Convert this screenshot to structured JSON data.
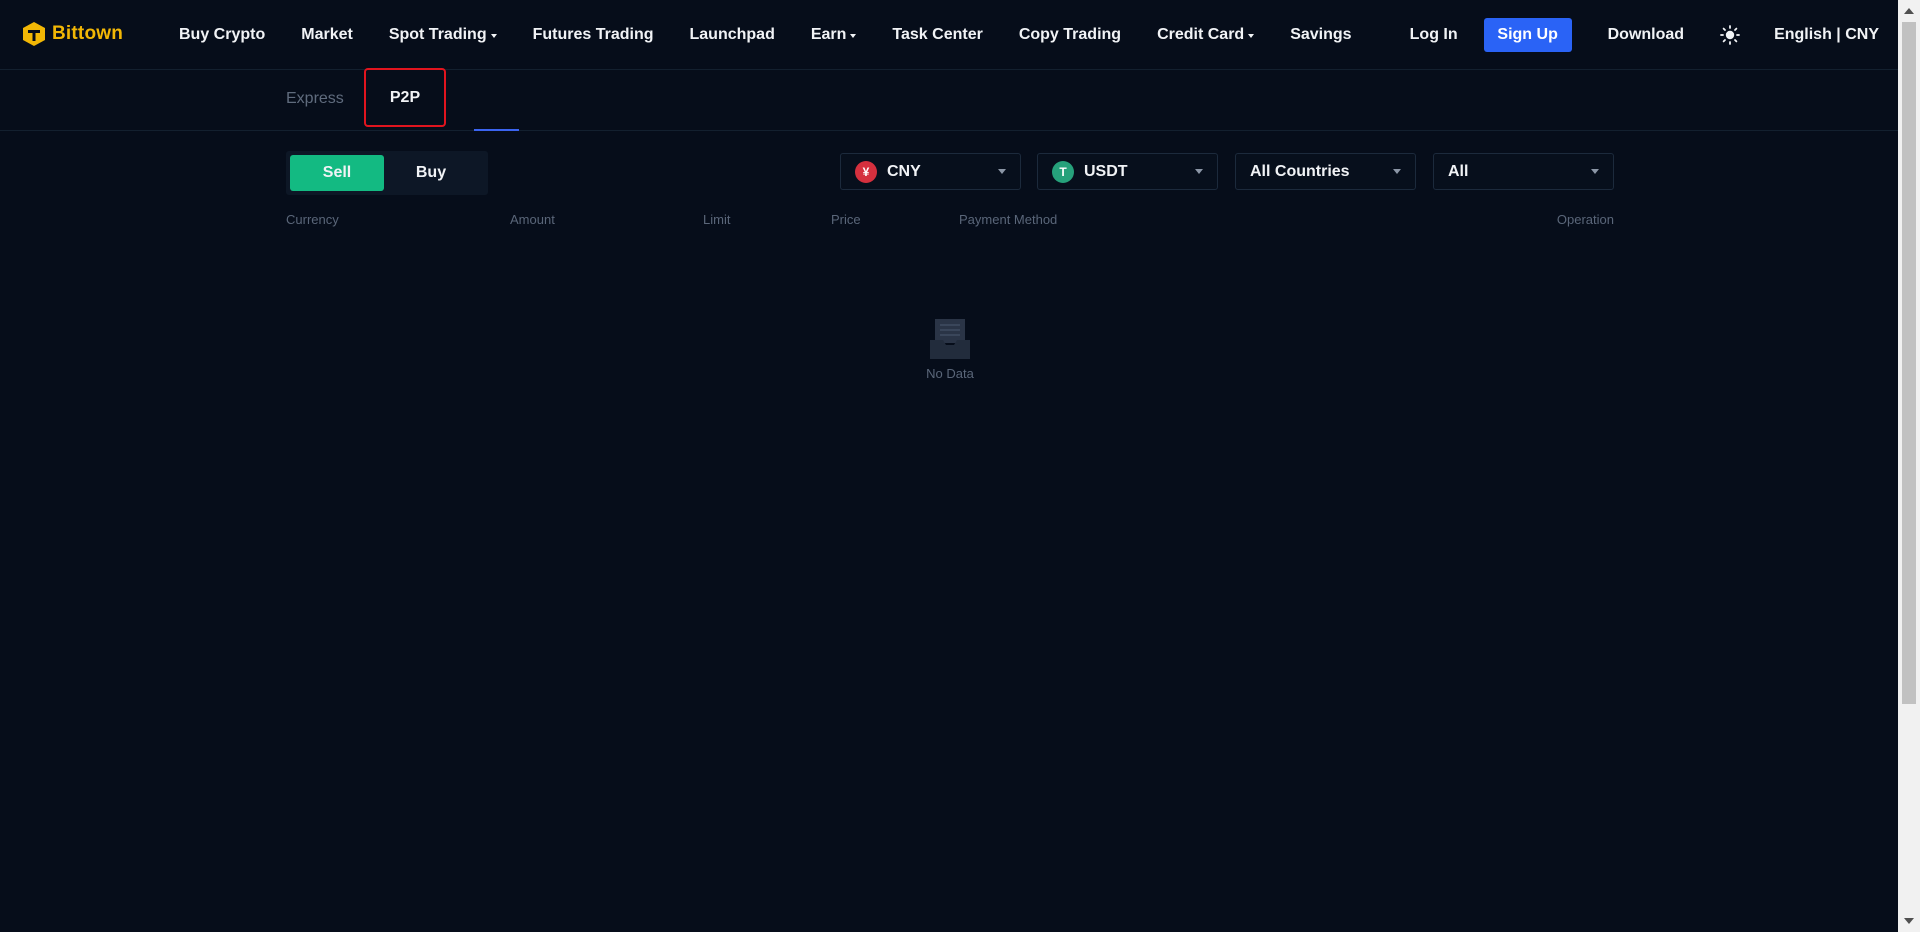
{
  "brand": {
    "name": "Bittown",
    "accent": "#f2b705"
  },
  "nav": {
    "items": [
      {
        "label": "Buy Crypto",
        "dropdown": false
      },
      {
        "label": "Market",
        "dropdown": false
      },
      {
        "label": "Spot Trading",
        "dropdown": true
      },
      {
        "label": "Futures Trading",
        "dropdown": false
      },
      {
        "label": "Launchpad",
        "dropdown": false
      },
      {
        "label": "Earn",
        "dropdown": true
      },
      {
        "label": "Task Center",
        "dropdown": false
      },
      {
        "label": "Copy Trading",
        "dropdown": false
      },
      {
        "label": "Credit Card",
        "dropdown": true
      },
      {
        "label": "Savings",
        "dropdown": false
      }
    ],
    "login_label": "Log In",
    "signup_label": "Sign Up",
    "download_label": "Download",
    "theme_icon": "sun-icon",
    "language_label": "English | CNY"
  },
  "tabs": {
    "express_label": "Express",
    "p2p_label": "P2P",
    "active": "P2P"
  },
  "filters": {
    "sell_label": "Sell",
    "buy_label": "Buy",
    "active_side": "Sell",
    "fiat": {
      "value": "CNY",
      "icon_glyph": "¥",
      "icon_color": "#d5303e"
    },
    "crypto": {
      "value": "USDT",
      "icon_glyph": "T",
      "icon_color": "#26a17b"
    },
    "country": {
      "value": "All Countries"
    },
    "payment": {
      "value": "All"
    }
  },
  "table": {
    "columns": [
      "Currency",
      "Amount",
      "Limit",
      "Price",
      "Payment Method",
      "Operation"
    ]
  },
  "empty_state": {
    "text": "No Data",
    "icon": "empty-box-icon"
  },
  "colors": {
    "background": "#060d1a",
    "primary_button": "#2a63f6",
    "sell_active": "#13ba82",
    "tab_underline": "#3b64f0",
    "highlight_box": "#e1141e"
  }
}
